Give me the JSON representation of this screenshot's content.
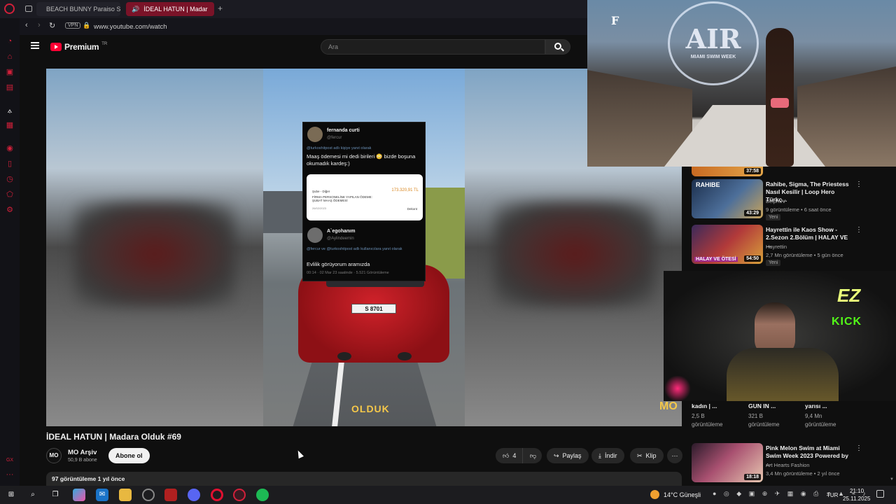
{
  "browser": {
    "tabs": [
      {
        "title": "BEACH BUNNY Paraiso Sw"
      },
      {
        "title": "İDEAL HATUN | Madar"
      }
    ],
    "url": "www.youtube.com/watch",
    "vpn_label": "VPN"
  },
  "header": {
    "brand": "Premium",
    "brand_suffix": "TR",
    "search_placeholder": "Ara"
  },
  "video": {
    "title": "İDEAL HATUN | Madara Olduk #69",
    "channel": "MO Arşiv",
    "subscribers": "50,9 B abone",
    "subscribe_label": "Abone ol",
    "likes": "4",
    "share_label": "Paylaş",
    "download_label": "İndir",
    "clip_label": "Klip",
    "views_line": "97 görüntüleme  1 yıl önce",
    "channel_logo": "MO",
    "overlay_text": "OLDUK",
    "tweet": {
      "user1": "fernanda curti",
      "handle1": "@fercur",
      "reply_to": "@turkoshitpost adlı kişiye yanıt olarak",
      "text1": "Maaş ödemesi mi  dedi birileri 😳 bizde boşuna okumadık kardeş:)",
      "amount": "173.320,91 TL",
      "card_line1": "Şube - Diğer",
      "card_line2": "FİRMA PERSONELİNE YAPILAN ÖDEME: ŞUBAT MAAŞ ÖDEMESİ",
      "card_date": "26/02/2023",
      "card_detail": "Dekont",
      "user2": "A`egohanım",
      "handle2": "@Aylindeemin",
      "reply2": "@fercur ve @turkoshitpost adlı kullanıcılara yanıt olarak",
      "text2": "Evlilik görüyorum aramızda",
      "meta2": "00:14 · 02 Mar 23 saatinde · 5.521 Görüntüleme"
    },
    "plate": "S 8701"
  },
  "sidebar_videos": [
    {
      "duration": "37:58",
      "title": "",
      "channel": "",
      "meta": ""
    },
    {
      "title": "Rahibe, Sigma, The Priestess Nasıl Kesilir | Loop Hero Türkç...",
      "channel": "Belph IV",
      "meta": "9 görüntüleme • 6 saat önce",
      "badge": "Yeni",
      "duration": "43:29",
      "thumb_text": "RAHIBE"
    },
    {
      "title": "Hayrettin ile Kaos Show - 2.Sezon 2.Bölüm | HALAY VE ...",
      "channel": "Hayrettin",
      "meta": "2,7 Mn görüntüleme • 5 gün önce",
      "badge": "Yeni",
      "duration": "54:50",
      "thumb_text": "HALAY VE ÖTESİ"
    },
    {
      "title": "Pink Melon Swim at Miami Swim Week 2023 Powered by ...",
      "channel": "Art Hearts Fashion",
      "meta": "3,4 Mn görüntüleme • 2 yıl önce",
      "duration": "18:18"
    }
  ],
  "shorts": [
    {
      "title": "kadın | ...",
      "views": "2,5 B",
      "label": "görüntüleme"
    },
    {
      "title": "GUN IN ...",
      "views": "321 B",
      "label": "görüntüleme"
    },
    {
      "title": "yarısı ...",
      "views": "9,4 Mn",
      "label": "görüntüleme"
    }
  ],
  "overlays": {
    "runway_logo": "AIR",
    "runway_sub": "MIAMI SWIM WEEK",
    "runway_brand": "F",
    "kick_line1": "EZ",
    "kick_line2": "KICK"
  },
  "taskbar": {
    "weather": "14°C  Güneşli",
    "lang": "TUR",
    "time": "21:10",
    "date": "25.11.2025"
  },
  "colors": {
    "accent": "#d2203a",
    "youtube_red": "#ff0033",
    "kick_green": "#53fc18"
  }
}
